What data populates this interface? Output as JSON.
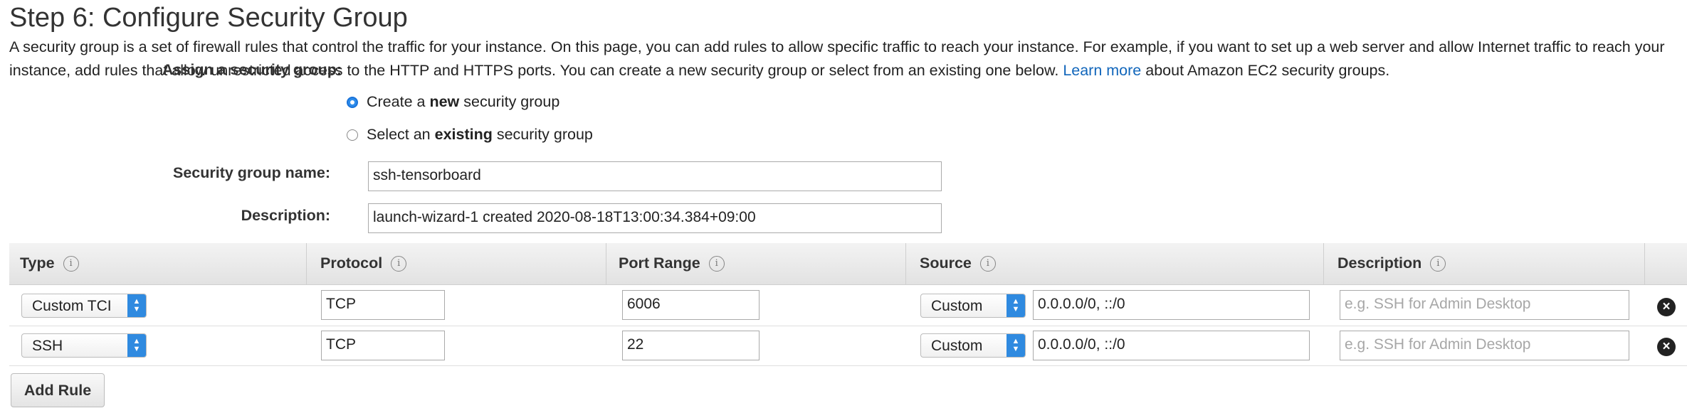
{
  "page": {
    "title": "Step 6: Configure Security Group",
    "intro_text": "A security group is a set of firewall rules that control the traffic for your instance. On this page, you can add rules to allow specific traffic to reach your instance. For example, if you want to set up a web server and allow Internet traffic to reach your instance, add rules that allow unrestricted access to the HTTP and HTTPS ports. You can create a new security group or select from an existing one below.",
    "learn_more": "Learn more",
    "intro_suffix": "about Amazon EC2 security groups."
  },
  "assign": {
    "label": "Assign a security group:",
    "option_new": {
      "pre": "Create a ",
      "bold": "new",
      "post": " security group",
      "selected": true
    },
    "option_existing": {
      "pre": "Select an ",
      "bold": "existing",
      "post": " security group",
      "selected": false
    }
  },
  "form": {
    "name_label": "Security group name:",
    "name_value": "ssh-tensorboard",
    "desc_label": "Description:",
    "desc_value": "launch-wizard-1 created 2020-08-18T13:00:34.384+09:00"
  },
  "table": {
    "headers": [
      "Type",
      "Protocol",
      "Port Range",
      "Source",
      "Description"
    ],
    "rows": [
      {
        "type": "Custom TCI",
        "protocol": "TCP",
        "port": "6006",
        "source": "Custom",
        "cidr": "0.0.0.0/0, ::/0",
        "desc_placeholder": "e.g. SSH for Admin Desktop"
      },
      {
        "type": "SSH",
        "protocol": "TCP",
        "port": "22",
        "source": "Custom",
        "cidr": "0.0.0.0/0, ::/0",
        "desc_placeholder": "e.g. SSH for Admin Desktop"
      }
    ]
  },
  "actions": {
    "add_rule": "Add Rule"
  },
  "icons": {
    "info": "info-icon",
    "delete": "remove-rule-icon",
    "select": "chevron-updown-icon"
  },
  "colors": {
    "link": "#1166bb",
    "accent": "#2d8ceb"
  }
}
